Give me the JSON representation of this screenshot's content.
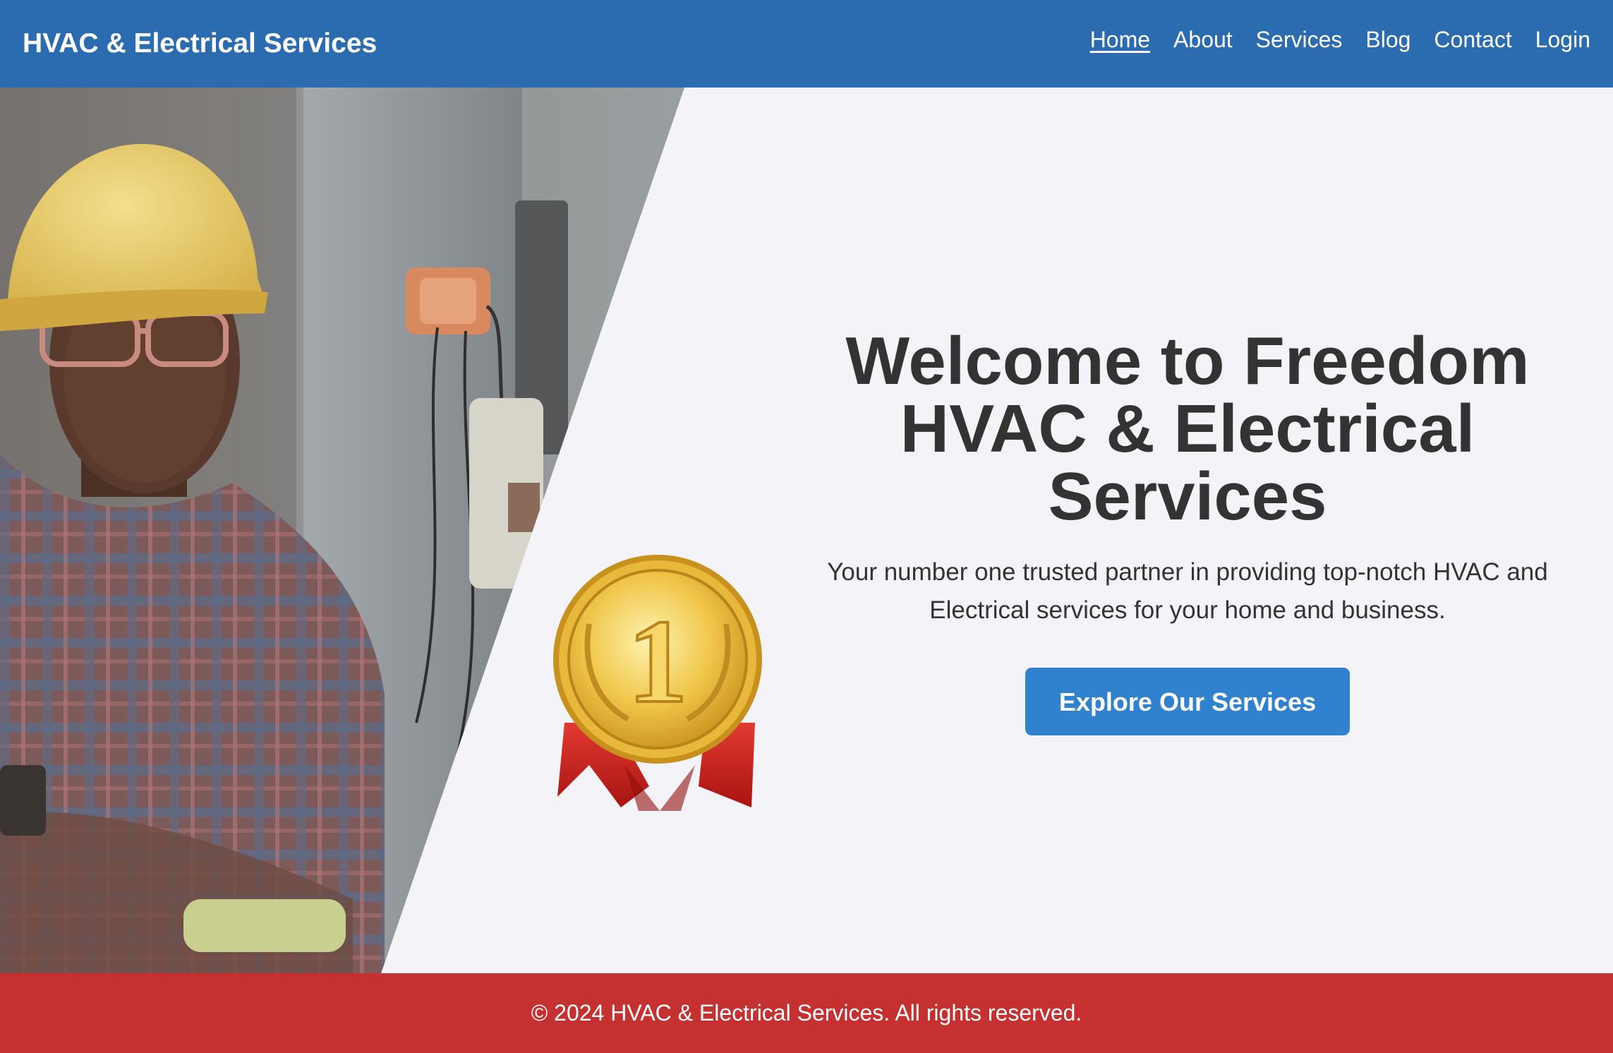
{
  "header": {
    "brand": "HVAC & Electrical Services",
    "nav": [
      {
        "label": "Home",
        "active": true
      },
      {
        "label": "About"
      },
      {
        "label": "Services"
      },
      {
        "label": "Blog"
      },
      {
        "label": "Contact"
      },
      {
        "label": "Login"
      }
    ]
  },
  "hero": {
    "title": "Welcome to Freedom HVAC & Electrical Services",
    "subtitle": "Your number one trusted partner in providing top-notch HVAC and Electrical services for your home and business.",
    "cta_label": "Explore Our Services",
    "medal_number": "1"
  },
  "footer": {
    "text": "© 2024 HVAC & Electrical Services. All rights reserved."
  },
  "colors": {
    "header_bg": "#2b6cb0",
    "cta_bg": "#3182ce",
    "footer_bg": "#c53030",
    "page_bg": "#f4f4f8",
    "heading_text": "#333333"
  }
}
